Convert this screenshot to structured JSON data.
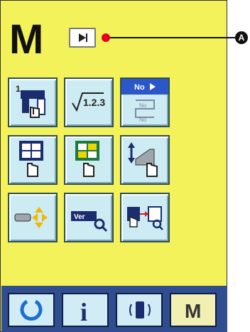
{
  "screen": {
    "mode_letter": "M",
    "callout_badge": "A"
  },
  "tiles": {
    "t1": {
      "name": "tile-1"
    },
    "t2": {
      "name": "tile-2",
      "label": "1.2.3"
    },
    "t3": {
      "name": "tile-3",
      "label": "No"
    },
    "t4": {
      "name": "tile-4"
    },
    "t5": {
      "name": "tile-5"
    },
    "t6": {
      "name": "tile-6"
    },
    "t7": {
      "name": "tile-7"
    },
    "t8": {
      "name": "tile-8",
      "label": "Ver"
    },
    "t9": {
      "name": "tile-9"
    }
  },
  "bottom": {
    "info_label": "i",
    "m_label": "M"
  },
  "colors": {
    "panel": "#f4f25a",
    "tile_bg": "#cdebf3",
    "bottom_bar": "#2f4d8f",
    "callout_dot": "#e4001f"
  }
}
